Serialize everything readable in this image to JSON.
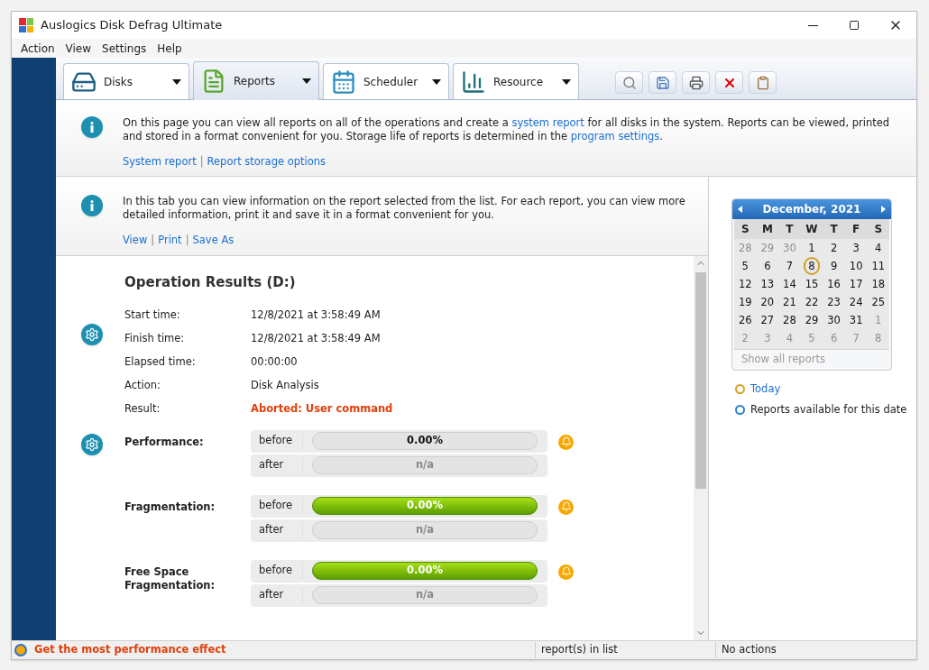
{
  "window": {
    "title": "Auslogics Disk Defrag Ultimate"
  },
  "menu": [
    "Action",
    "View",
    "Settings",
    "Help"
  ],
  "tabs": [
    {
      "label": "Disks",
      "selected": false,
      "kind": "disk"
    },
    {
      "label": "Reports",
      "selected": true,
      "kind": "report"
    },
    {
      "label": "Scheduler",
      "selected": false,
      "kind": "calendar"
    },
    {
      "label": "Resource",
      "selected": false,
      "kind": "chart"
    }
  ],
  "toolbar": [
    {
      "kind": "search"
    },
    {
      "kind": "save"
    },
    {
      "kind": "print"
    },
    {
      "kind": "delete"
    },
    {
      "kind": "clipboard"
    }
  ],
  "page_info": {
    "text": "On this page you can view all reports on all of the operations and create a ",
    "link1": "system report",
    "text2": " for all disks in the system. Reports can be viewed, printed and stored in a format convenient for you. Storage life of reports is determined in the ",
    "link2": "program settings",
    "text3": ".",
    "links": [
      "System report",
      "Report storage options"
    ],
    "separator": "|"
  },
  "tab_info": {
    "text": "In this tab you can view information on the report selected from the list. For each report, you can view more detailed information, print it and save it in a format convenient for you.",
    "links": [
      "View",
      "Print",
      "Save As"
    ],
    "separator": "|"
  },
  "report": {
    "title": "Operation Results (D:)",
    "details": [
      {
        "label": "Start time:",
        "value": "12/8/2021 at 3:58:49 AM",
        "alert": false
      },
      {
        "label": "Finish time:",
        "value": "12/8/2021 at 3:58:49 AM",
        "alert": false
      },
      {
        "label": "Elapsed time:",
        "value": "00:00:00",
        "alert": false
      },
      {
        "label": "Action:",
        "value": "Disk Analysis",
        "alert": false
      },
      {
        "label": "Result:",
        "value": "Aborted: User command",
        "alert": true
      }
    ],
    "metrics": [
      {
        "name": "Performance:",
        "rows": [
          {
            "label": "before",
            "value": "0.00%",
            "filled": false,
            "disabled": false
          },
          {
            "label": "after",
            "value": "n/a",
            "filled": false,
            "disabled": true
          }
        ]
      },
      {
        "name": "Fragmentation:",
        "rows": [
          {
            "label": "before",
            "value": "0.00%",
            "filled": true,
            "disabled": false
          },
          {
            "label": "after",
            "value": "n/a",
            "filled": false,
            "disabled": true
          }
        ]
      },
      {
        "name": "Free Space Fragmentation:",
        "rows": [
          {
            "label": "before",
            "value": "0.00%",
            "filled": true,
            "disabled": false
          },
          {
            "label": "after",
            "value": "n/a",
            "filled": false,
            "disabled": true
          }
        ]
      }
    ]
  },
  "calendar": {
    "month": "December, 2021",
    "weekdays": [
      "S",
      "M",
      "T",
      "W",
      "T",
      "F",
      "S"
    ],
    "weeks": [
      [
        {
          "day": "28",
          "muted": true,
          "today": false
        },
        {
          "day": "29",
          "muted": true,
          "today": false
        },
        {
          "day": "30",
          "muted": true,
          "today": false
        },
        {
          "day": "1",
          "muted": false,
          "today": false
        },
        {
          "day": "2",
          "muted": false,
          "today": false
        },
        {
          "day": "3",
          "muted": false,
          "today": false
        },
        {
          "day": "4",
          "muted": false,
          "today": false
        }
      ],
      [
        {
          "day": "5",
          "muted": false,
          "today": false
        },
        {
          "day": "6",
          "muted": false,
          "today": false
        },
        {
          "day": "7",
          "muted": false,
          "today": false
        },
        {
          "day": "8",
          "muted": false,
          "today": true
        },
        {
          "day": "9",
          "muted": false,
          "today": false
        },
        {
          "day": "10",
          "muted": false,
          "today": false
        },
        {
          "day": "11",
          "muted": false,
          "today": false
        }
      ],
      [
        {
          "day": "12",
          "muted": false,
          "today": false
        },
        {
          "day": "13",
          "muted": false,
          "today": false
        },
        {
          "day": "14",
          "muted": false,
          "today": false
        },
        {
          "day": "15",
          "muted": false,
          "today": false
        },
        {
          "day": "16",
          "muted": false,
          "today": false
        },
        {
          "day": "17",
          "muted": false,
          "today": false
        },
        {
          "day": "18",
          "muted": false,
          "today": false
        }
      ],
      [
        {
          "day": "19",
          "muted": false,
          "today": false
        },
        {
          "day": "20",
          "muted": false,
          "today": false
        },
        {
          "day": "21",
          "muted": false,
          "today": false
        },
        {
          "day": "22",
          "muted": false,
          "today": false
        },
        {
          "day": "23",
          "muted": false,
          "today": false
        },
        {
          "day": "24",
          "muted": false,
          "today": false
        },
        {
          "day": "25",
          "muted": false,
          "today": false
        }
      ],
      [
        {
          "day": "26",
          "muted": false,
          "today": false
        },
        {
          "day": "27",
          "muted": false,
          "today": false
        },
        {
          "day": "28",
          "muted": false,
          "today": false
        },
        {
          "day": "29",
          "muted": false,
          "today": false
        },
        {
          "day": "30",
          "muted": false,
          "today": false
        },
        {
          "day": "31",
          "muted": false,
          "today": false
        },
        {
          "day": "1",
          "muted": true,
          "today": false
        }
      ],
      [
        {
          "day": "2",
          "muted": true,
          "today": false
        },
        {
          "day": "3",
          "muted": true,
          "today": false
        },
        {
          "day": "4",
          "muted": true,
          "today": false
        },
        {
          "day": "5",
          "muted": true,
          "today": false
        },
        {
          "day": "6",
          "muted": true,
          "today": false
        },
        {
          "day": "7",
          "muted": true,
          "today": false
        },
        {
          "day": "8",
          "muted": true,
          "today": false
        }
      ]
    ],
    "show_all": "Show all reports",
    "legend": [
      {
        "label": "Today",
        "color": "#d4a02a",
        "kind": "link"
      },
      {
        "label": "Reports available for this date",
        "color": "#2f7fd0",
        "kind": "text"
      }
    ]
  },
  "status_bar": {
    "promo": "Get the most performance effect",
    "count": "report(s) in list",
    "actions": "No actions"
  }
}
